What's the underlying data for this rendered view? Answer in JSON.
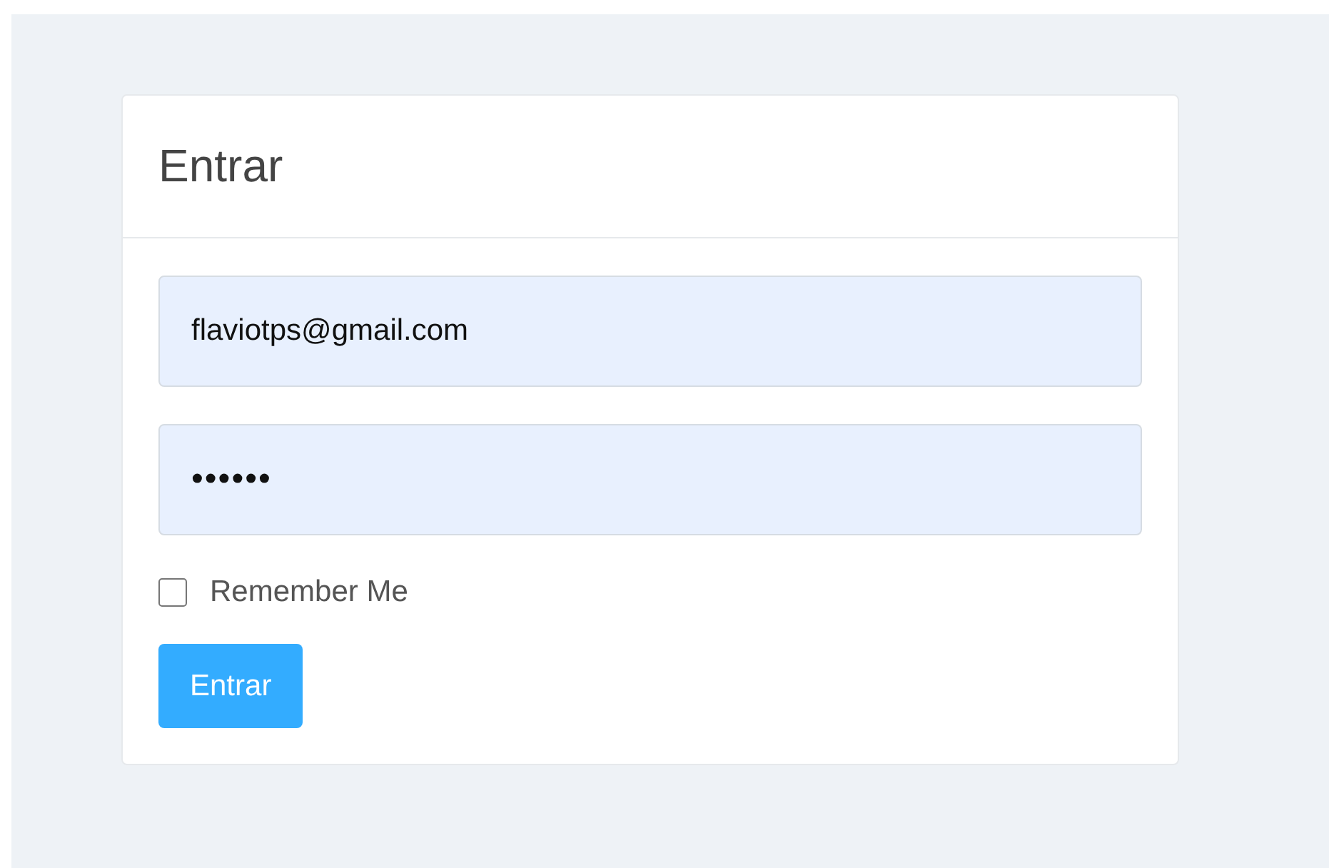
{
  "card": {
    "title": "Entrar"
  },
  "fields": [
    {
      "kind": "email",
      "value": "flaviotps@gmail.com"
    },
    {
      "kind": "password",
      "value": "••••••"
    }
  ],
  "remember": {
    "label": "Remember Me",
    "checked": false
  },
  "submit": {
    "label": "Entrar"
  }
}
